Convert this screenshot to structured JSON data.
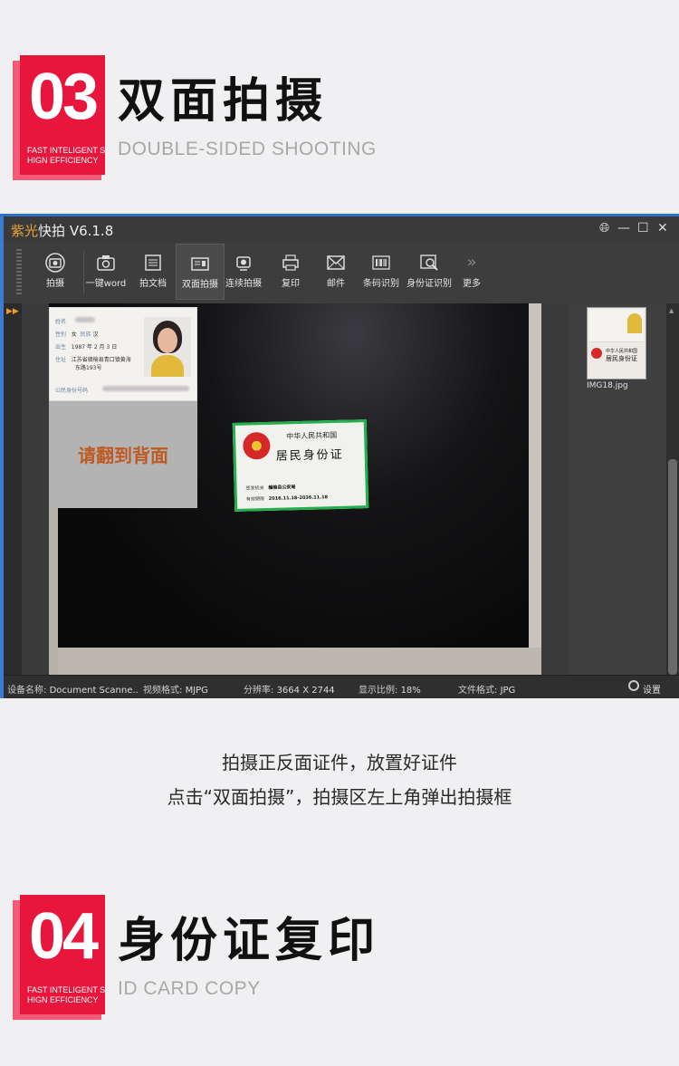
{
  "section1": {
    "number": "03",
    "badge_line1": "FAST INTELIGENT S",
    "badge_line2": "HIGN EFFICIENCY",
    "title": "双面拍摄",
    "subtitle": "DOUBLE-SIDED SHOOTING"
  },
  "app": {
    "brand": "紫光",
    "name": "快拍",
    "version": "V6.1.8",
    "toolbar": [
      {
        "label": "拍摄",
        "icon": "camera-icon"
      },
      {
        "label": "一键word",
        "icon": "camera-word-icon"
      },
      {
        "label": "拍文档",
        "icon": "document-icon"
      },
      {
        "label": "双面拍摄",
        "icon": "id-card-icon"
      },
      {
        "label": "连续拍摄",
        "icon": "continuous-camera-icon"
      },
      {
        "label": "复印",
        "icon": "printer-icon"
      },
      {
        "label": "邮件",
        "icon": "mail-icon"
      },
      {
        "label": "条码识别",
        "icon": "barcode-icon"
      },
      {
        "label": "身份证识别",
        "icon": "id-scan-icon"
      },
      {
        "label": "更多",
        "icon": "chevrons-right-icon"
      }
    ],
    "preview": {
      "front_card": {
        "name_label": "姓名",
        "sex_label": "性别",
        "sex_value": "女",
        "ethnic_label": "民族",
        "ethnic_value": "汉",
        "birth_label": "出生",
        "birth_value": "1987 年 2 月 3 日",
        "address_label": "住址",
        "address_line1": "江苏省赣榆县青口镇黄海",
        "address_line2": "东路193号",
        "id_label": "公民身份号码"
      },
      "flip_prompt": "请翻到背面",
      "back_card": {
        "country": "中华人民共和国",
        "title": "居民身份证",
        "authority_label": "签发机关",
        "authority_value": "赣榆县公安局",
        "validity_label": "有效期限",
        "validity_value": "2016.11.18-2036.11.18"
      }
    },
    "gallery": {
      "thumb_name": "IMG18.jpg",
      "thumb_country": "中华人民共和国",
      "thumb_title": "居民身份证"
    },
    "status": {
      "device_label": "设备名称:",
      "device_value": "Document Scanne..",
      "video_label": "视频格式:",
      "video_value": "MJPG",
      "resolution_label": "分辨率:",
      "resolution_value": "3664 X 2744",
      "ratio_label": "显示比例:",
      "ratio_value": "18%",
      "filetype_label": "文件格式:",
      "filetype_value": "JPG",
      "settings_label": "设置"
    }
  },
  "caption": {
    "line1": "拍摄正反面证件，放置好证件",
    "line2": "点击“双面拍摄”，拍摄区左上角弹出拍摄框"
  },
  "section2": {
    "number": "04",
    "badge_line1": "FAST INTELIGENT S",
    "badge_line2": "HIGN EFFICIENCY",
    "title": "身份证复印",
    "subtitle": "ID CARD COPY"
  }
}
